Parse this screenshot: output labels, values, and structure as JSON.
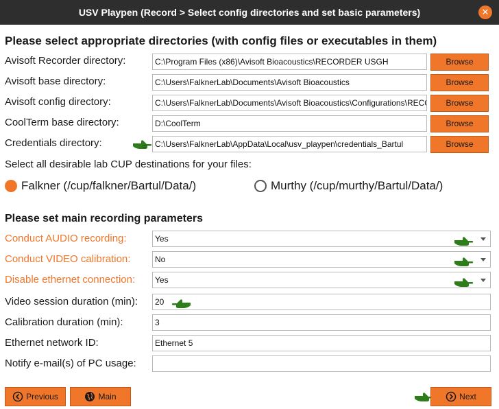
{
  "window": {
    "title": "USV Playpen (Record > Select config directories and set basic parameters)",
    "close_glyph": "✕"
  },
  "directories": {
    "heading": "Please select appropriate directories (with config files or executables in them)",
    "browse_label": "Browse",
    "rows": [
      {
        "label": "Avisoft Recorder directory:",
        "value": "C:\\Program Files (x86)\\Avisoft Bioacoustics\\RECORDER USGH"
      },
      {
        "label": "Avisoft base directory:",
        "value": "C:\\Users\\FalknerLab\\Documents\\Avisoft Bioacoustics"
      },
      {
        "label": "Avisoft config directory:",
        "value": "C:\\Users\\FalknerLab\\Documents\\Avisoft Bioacoustics\\Configurations\\RECORDER_USGH"
      },
      {
        "label": "CoolTerm base directory:",
        "value": "D:\\CoolTerm"
      },
      {
        "label": "Credentials directory:",
        "value": "C:\\Users\\FalknerLab\\AppData\\Local\\usv_playpen\\credentials_Bartul"
      }
    ]
  },
  "cup": {
    "prompt": "Select all desirable lab CUP destinations for your files:",
    "options": [
      {
        "label": "Falkner (/cup/falkner/Bartul/Data/)",
        "checked": true
      },
      {
        "label": "Murthy (/cup/murthy/Bartul/Data/)",
        "checked": false
      }
    ]
  },
  "params": {
    "heading": "Please set main recording parameters",
    "audio": {
      "label": "Conduct AUDIO recording:",
      "value": "Yes"
    },
    "video_cal": {
      "label": "Conduct VIDEO calibration:",
      "value": "No"
    },
    "ethernet_disable": {
      "label": "Disable ethernet connection:",
      "value": "Yes"
    },
    "video_duration": {
      "label": "Video session duration (min):",
      "value": "20"
    },
    "cal_duration": {
      "label": "Calibration duration (min):",
      "value": "3"
    },
    "ethernet_id": {
      "label": "Ethernet network ID:",
      "value": "Ethernet 5"
    },
    "notify": {
      "label": "Notify e-mail(s) of PC usage:",
      "value": ""
    }
  },
  "nav": {
    "previous": "Previous",
    "main": "Main",
    "next": "Next"
  },
  "colors": {
    "accent": "#f0762a",
    "titlebar": "#2e2e2e",
    "hand": "#2e7d1a"
  },
  "icons": {
    "hint": "pointing-hand-icon",
    "previous": "circle-arrow-left-icon",
    "main": "globe-icon",
    "next": "circle-arrow-right-icon"
  }
}
